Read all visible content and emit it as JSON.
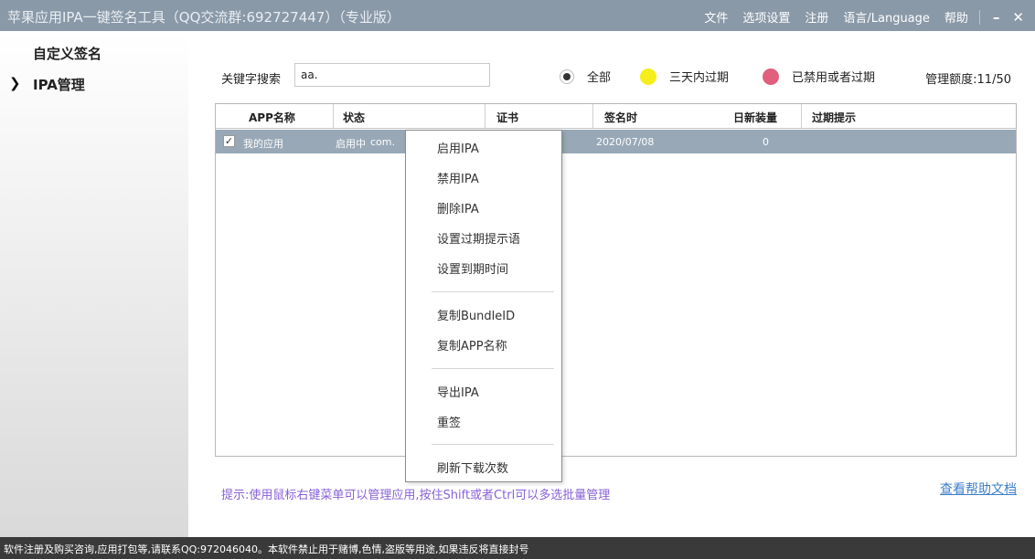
{
  "window": {
    "title": "苹果应用IPA一键签名工具（QQ交流群:692727447）（专业版）",
    "menu": [
      "文件",
      "选项设置",
      "注册",
      "语言/Language",
      "帮助"
    ],
    "minimize": "–",
    "close": "✕"
  },
  "sidebar": {
    "items": [
      {
        "label": "自定义签名",
        "active": false
      },
      {
        "label": "IPA管理",
        "active": true
      }
    ],
    "active_marker": "❯"
  },
  "search": {
    "label": "关键字搜索",
    "value": "aa."
  },
  "filters": [
    {
      "label": "全部",
      "selected": true
    },
    {
      "label": "三天内过期",
      "color": "#f5ee1c"
    },
    {
      "label": "已禁用或者过期",
      "color": "#e0607e"
    }
  ],
  "quota": "管理额度:11/50",
  "table": {
    "columns": [
      "APP名称",
      "状态",
      "证书",
      "签名时",
      "日新装量",
      "过期提示"
    ],
    "rows": [
      {
        "checked": true,
        "app_name": "我的应用",
        "status": "启用中",
        "bundle": "com.",
        "sign_date": "2020/07/08",
        "new_installs": "0",
        "expire_hint": ""
      }
    ]
  },
  "context_menu": {
    "groups": [
      [
        "启用IPA",
        "禁用IPA",
        "删除IPA",
        "设置过期提示语",
        "设置到期时间"
      ],
      [
        "复制BundleID",
        "复制APP名称"
      ],
      [
        "导出IPA",
        "重签"
      ],
      [
        "刷新下载次数"
      ]
    ]
  },
  "hint": "提示:使用鼠标右键菜单可以管理应用,按住Shift或者Ctrl可以多选批量管理",
  "help_link": "查看帮助文档",
  "status_bar": "软件注册及购买咨询,应用打包等,请联系QQ:972046040。本软件禁止用于赌博,色情,盗版等用途,如果违反将直接封号"
}
